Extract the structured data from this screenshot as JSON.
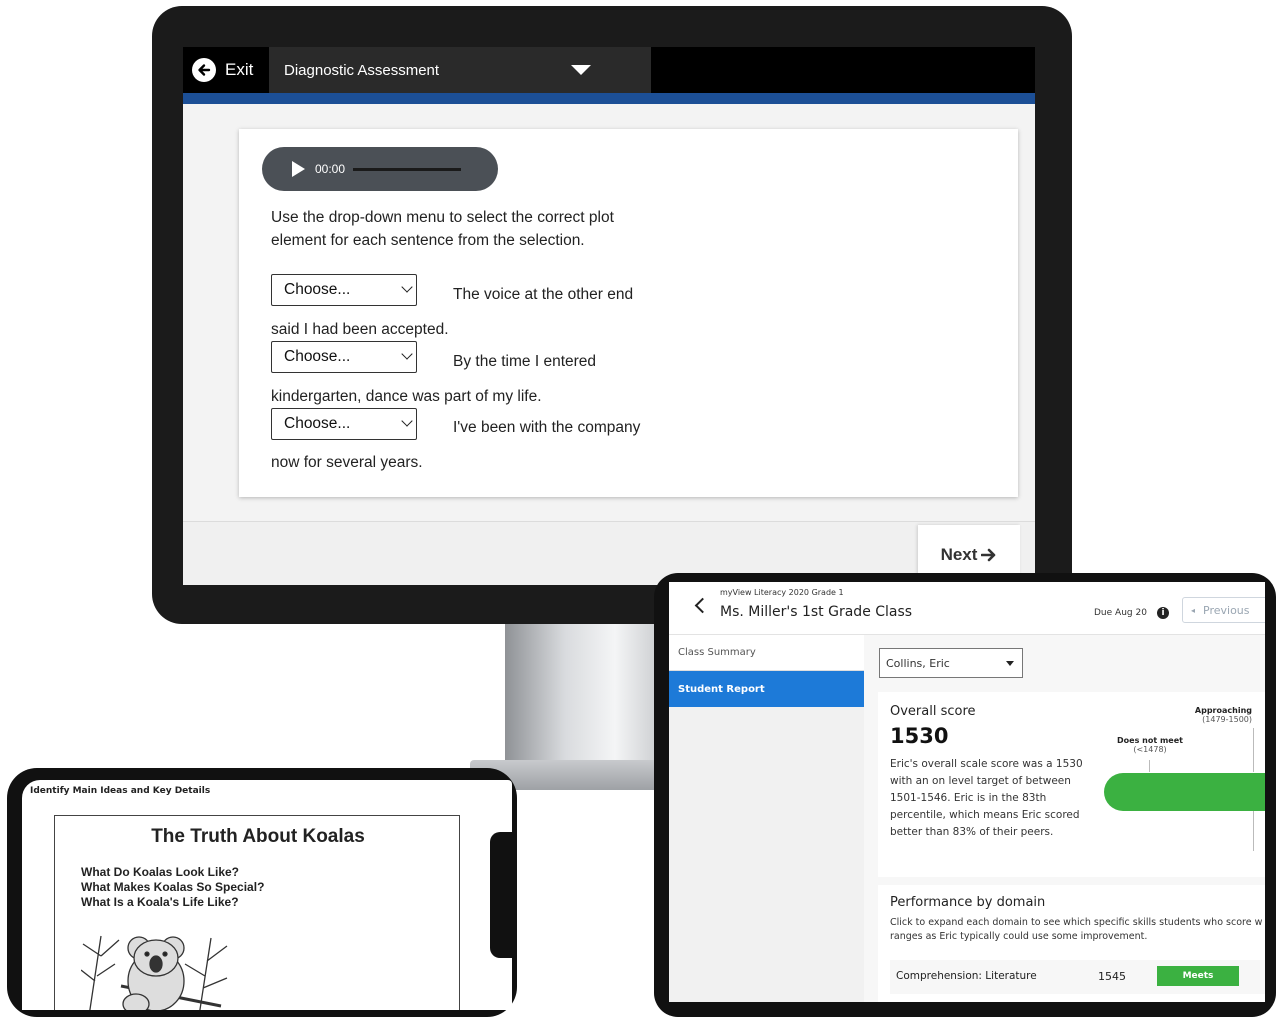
{
  "assessment": {
    "exit_label": "Exit",
    "title": "Diagnostic Assessment",
    "audio_time": "00:00",
    "instruction": "Use the drop-down menu to select the correct plot element for each sentence from the selection.",
    "questions": [
      {
        "select_value": "Choose...",
        "sentence_start": "The voice at the other end",
        "sentence_end": "said I had been accepted."
      },
      {
        "select_value": "Choose...",
        "sentence_start": "By the time I entered",
        "sentence_end": "kindergarten, dance was part of my life."
      },
      {
        "select_value": "Choose...",
        "sentence_start": "I've been with the company",
        "sentence_end": "now for several years."
      }
    ],
    "next_label": "Next",
    "colors": {
      "accent_bar": "#1c4f96",
      "topbar": "#000000"
    }
  },
  "report": {
    "program": "myView Literacy 2020 Grade 1",
    "class_title": "Ms. Miller's 1st Grade Class",
    "due": "Due Aug 20",
    "previous_label": "Previous",
    "sidebar": [
      {
        "label": "Class Summary",
        "active": false
      },
      {
        "label": "Student Report",
        "active": true
      }
    ],
    "student_select": "Collins, Eric",
    "overall": {
      "title": "Overall score",
      "score": "1530",
      "text": "Eric's overall scale score was a 1530 with an on level target of between 1501-1546. Eric is in the 83th percentile, which means Eric scored better than 83% of their peers.",
      "levels": [
        {
          "name": "Does not meet",
          "range": "(<1478)"
        },
        {
          "name": "Approaching",
          "range": "(1479-1500)"
        }
      ]
    },
    "domain": {
      "title": "Performance by domain",
      "text": "Click to expand each domain to see which specific skills students who score w ranges as Eric typically could use some improvement.",
      "rows": [
        {
          "label": "Comprehension: Literature",
          "score": "1545",
          "status": "Meets"
        }
      ]
    },
    "colors": {
      "active_blue": "#1d7ad8",
      "meets_green": "#3bb141"
    }
  },
  "phone": {
    "header": "Identify Main Ideas and Key Details",
    "title": "The Truth About Koalas",
    "questions": [
      "What Do Koalas Look Like?",
      "What Makes Koalas So Special?",
      "What Is a Koala's Life Like?"
    ]
  }
}
